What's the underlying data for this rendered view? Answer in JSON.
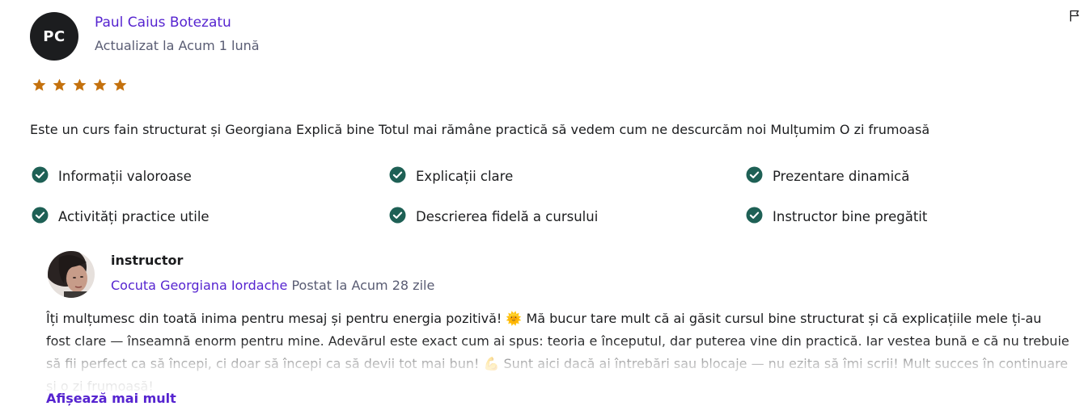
{
  "review": {
    "avatar_initials": "PC",
    "author": "Paul Caius Botezatu",
    "updated": "Actualizat la Acum 1 lună",
    "rating": 5,
    "star_color": "#c4710d",
    "text": "Este un curs fain structurat și Georgiana Explică bine Totul mai rămâne practică să vedem cum ne descurcăm noi Mulțumim O zi frumoasă",
    "flag_icon": "flag-icon",
    "tags": [
      "Informații valoroase",
      "Explicații clare",
      "Prezentare dinamică",
      "Activități practice utile",
      "Descrierea fidelă a cursului",
      "Instructor bine pregătit"
    ],
    "check_color": "#1e6055"
  },
  "response": {
    "role": "instructor",
    "name": "Cocuta Georgiana Iordache",
    "posted": "Postat la Acum 28 zile",
    "text": "Îți mulțumesc din toată inima pentru mesaj și pentru energia pozitivă! 🌞 Mă bucur tare mult că ai găsit cursul bine structurat și că explicațiile mele ți-au fost clare — înseamnă enorm pentru mine. Adevărul este exact cum ai spus: teoria e începutul, dar puterea vine din practică. Iar vestea bună e că nu trebuie să fii perfect ca să începi, ci doar să începi ca să devii tot mai bun! 💪 Sunt aici dacă ai întrebări sau blocaje — nu ezita să îmi scrii! Mult succes în continuare și o zi frumoasă!",
    "show_more": "Afișează mai mult"
  }
}
